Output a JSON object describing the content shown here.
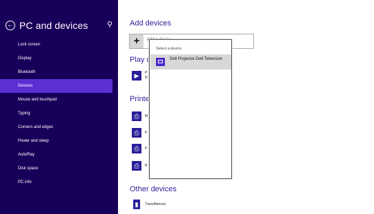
{
  "sidebar": {
    "title": "PC and devices",
    "items": [
      {
        "label": "Lock screen"
      },
      {
        "label": "Display"
      },
      {
        "label": "Bluetooth"
      },
      {
        "label": "Devices"
      },
      {
        "label": "Mouse and touchpad"
      },
      {
        "label": "Typing"
      },
      {
        "label": "Corners and edges"
      },
      {
        "label": "Power and sleep"
      },
      {
        "label": "AutoPlay"
      },
      {
        "label": "Disk space"
      },
      {
        "label": "PC info"
      }
    ]
  },
  "main": {
    "add_devices": {
      "heading": "Add devices",
      "button_label": "Add a device"
    },
    "play_devices": {
      "heading": "Play d",
      "items": [
        {
          "text1": "P",
          "text2": "N"
        }
      ]
    },
    "printers": {
      "heading": "Printer",
      "items": [
        {
          "text": "M"
        },
        {
          "text": "P"
        },
        {
          "text": "P"
        },
        {
          "text": "B"
        }
      ]
    },
    "other_devices": {
      "heading": "Other devices",
      "items": [
        {
          "label": "TransMemory"
        }
      ]
    }
  },
  "flyout": {
    "title": "Select a device",
    "items": [
      {
        "label": "Dell Projector-Dell Television"
      }
    ]
  },
  "colors": {
    "sidebar_bg": "#18005a",
    "active_bg": "#5b2fd3",
    "heading": "#2a1f99"
  }
}
